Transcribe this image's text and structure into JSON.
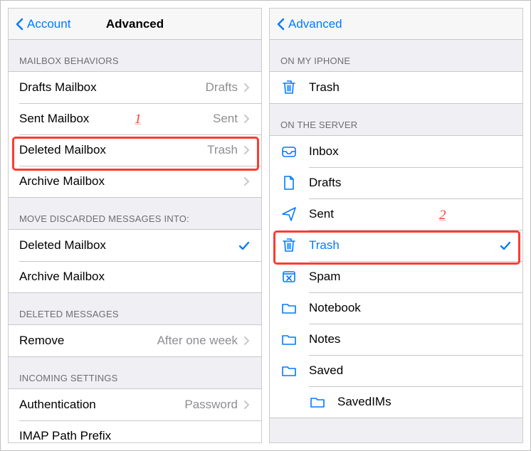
{
  "left": {
    "nav": {
      "back": "Account",
      "title": "Advanced"
    },
    "sections": {
      "mailbox_behaviors": {
        "header": "Mailbox Behaviors",
        "rows": [
          {
            "label": "Drafts Mailbox",
            "detail": "Drafts"
          },
          {
            "label": "Sent Mailbox",
            "detail": "Sent"
          },
          {
            "label": "Deleted Mailbox",
            "detail": "Trash"
          },
          {
            "label": "Archive Mailbox",
            "detail": ""
          }
        ]
      },
      "move_discarded": {
        "header": "Move Discarded Messages Into:",
        "rows": [
          {
            "label": "Deleted Mailbox",
            "checked": true
          },
          {
            "label": "Archive Mailbox",
            "checked": false
          }
        ]
      },
      "deleted_messages": {
        "header": "Deleted Messages",
        "rows": [
          {
            "label": "Remove",
            "detail": "After one week"
          }
        ]
      },
      "incoming": {
        "header": "Incoming Settings",
        "rows": [
          {
            "label": "Authentication",
            "detail": "Password"
          },
          {
            "label": "IMAP Path Prefix",
            "detail": ""
          }
        ]
      }
    }
  },
  "right": {
    "nav": {
      "back": "Advanced",
      "title": ""
    },
    "sections": {
      "on_my_iphone": {
        "header": "On My iPhone",
        "rows": [
          {
            "icon": "trash",
            "label": "Trash",
            "selected": false
          }
        ]
      },
      "on_the_server": {
        "header": "On the Server",
        "rows": [
          {
            "icon": "inbox",
            "label": "Inbox"
          },
          {
            "icon": "file",
            "label": "Drafts"
          },
          {
            "icon": "send",
            "label": "Sent"
          },
          {
            "icon": "trash",
            "label": "Trash",
            "selected": true
          },
          {
            "icon": "spam",
            "label": "Spam"
          },
          {
            "icon": "folder",
            "label": "Notebook"
          },
          {
            "icon": "folder",
            "label": "Notes"
          },
          {
            "icon": "folder",
            "label": "Saved"
          },
          {
            "icon": "folder",
            "label": "SavedIMs",
            "indent": true
          }
        ]
      }
    }
  },
  "annotations": {
    "one": "1",
    "two": "2"
  }
}
